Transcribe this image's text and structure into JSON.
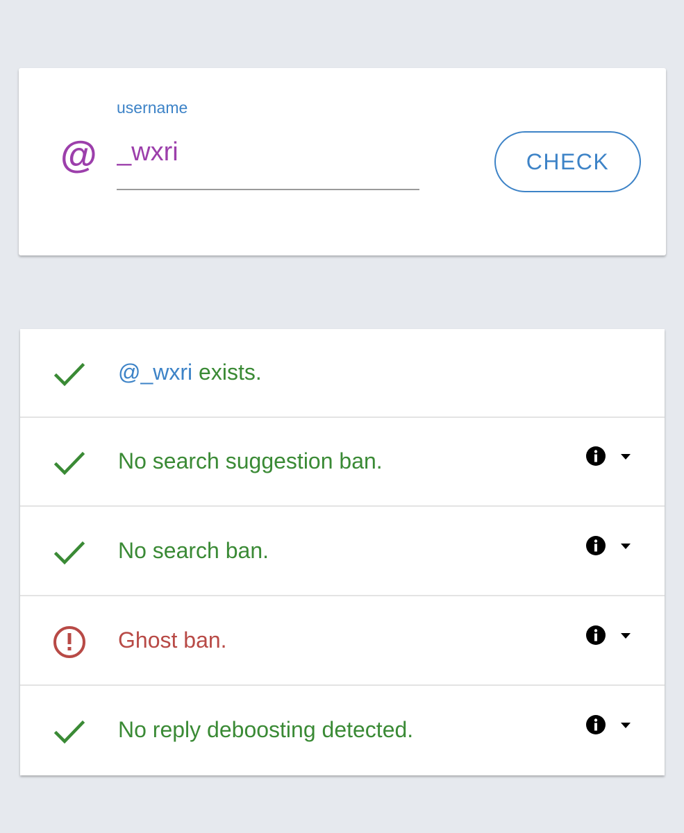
{
  "search": {
    "at_symbol": "@",
    "label": "username",
    "value": "_wxri",
    "button_label": "CHECK"
  },
  "results": [
    {
      "status": "ok",
      "user": "@_wxri",
      "text": " exists.",
      "has_info": false
    },
    {
      "status": "ok",
      "text": "No search suggestion ban.",
      "has_info": true
    },
    {
      "status": "ok",
      "text": "No search ban.",
      "has_info": true
    },
    {
      "status": "ban",
      "text": "Ghost ban.",
      "has_info": true
    },
    {
      "status": "ok",
      "text": "No reply deboosting detected.",
      "has_info": true
    }
  ],
  "icons": {
    "ok": "check-icon",
    "ban": "alert-circle-icon",
    "info": "info-icon",
    "expand": "caret-down-icon"
  },
  "colors": {
    "ok": "#3a8a35",
    "ban": "#b84a46",
    "accent": "#3d83c7",
    "username": "#9c3fab"
  }
}
